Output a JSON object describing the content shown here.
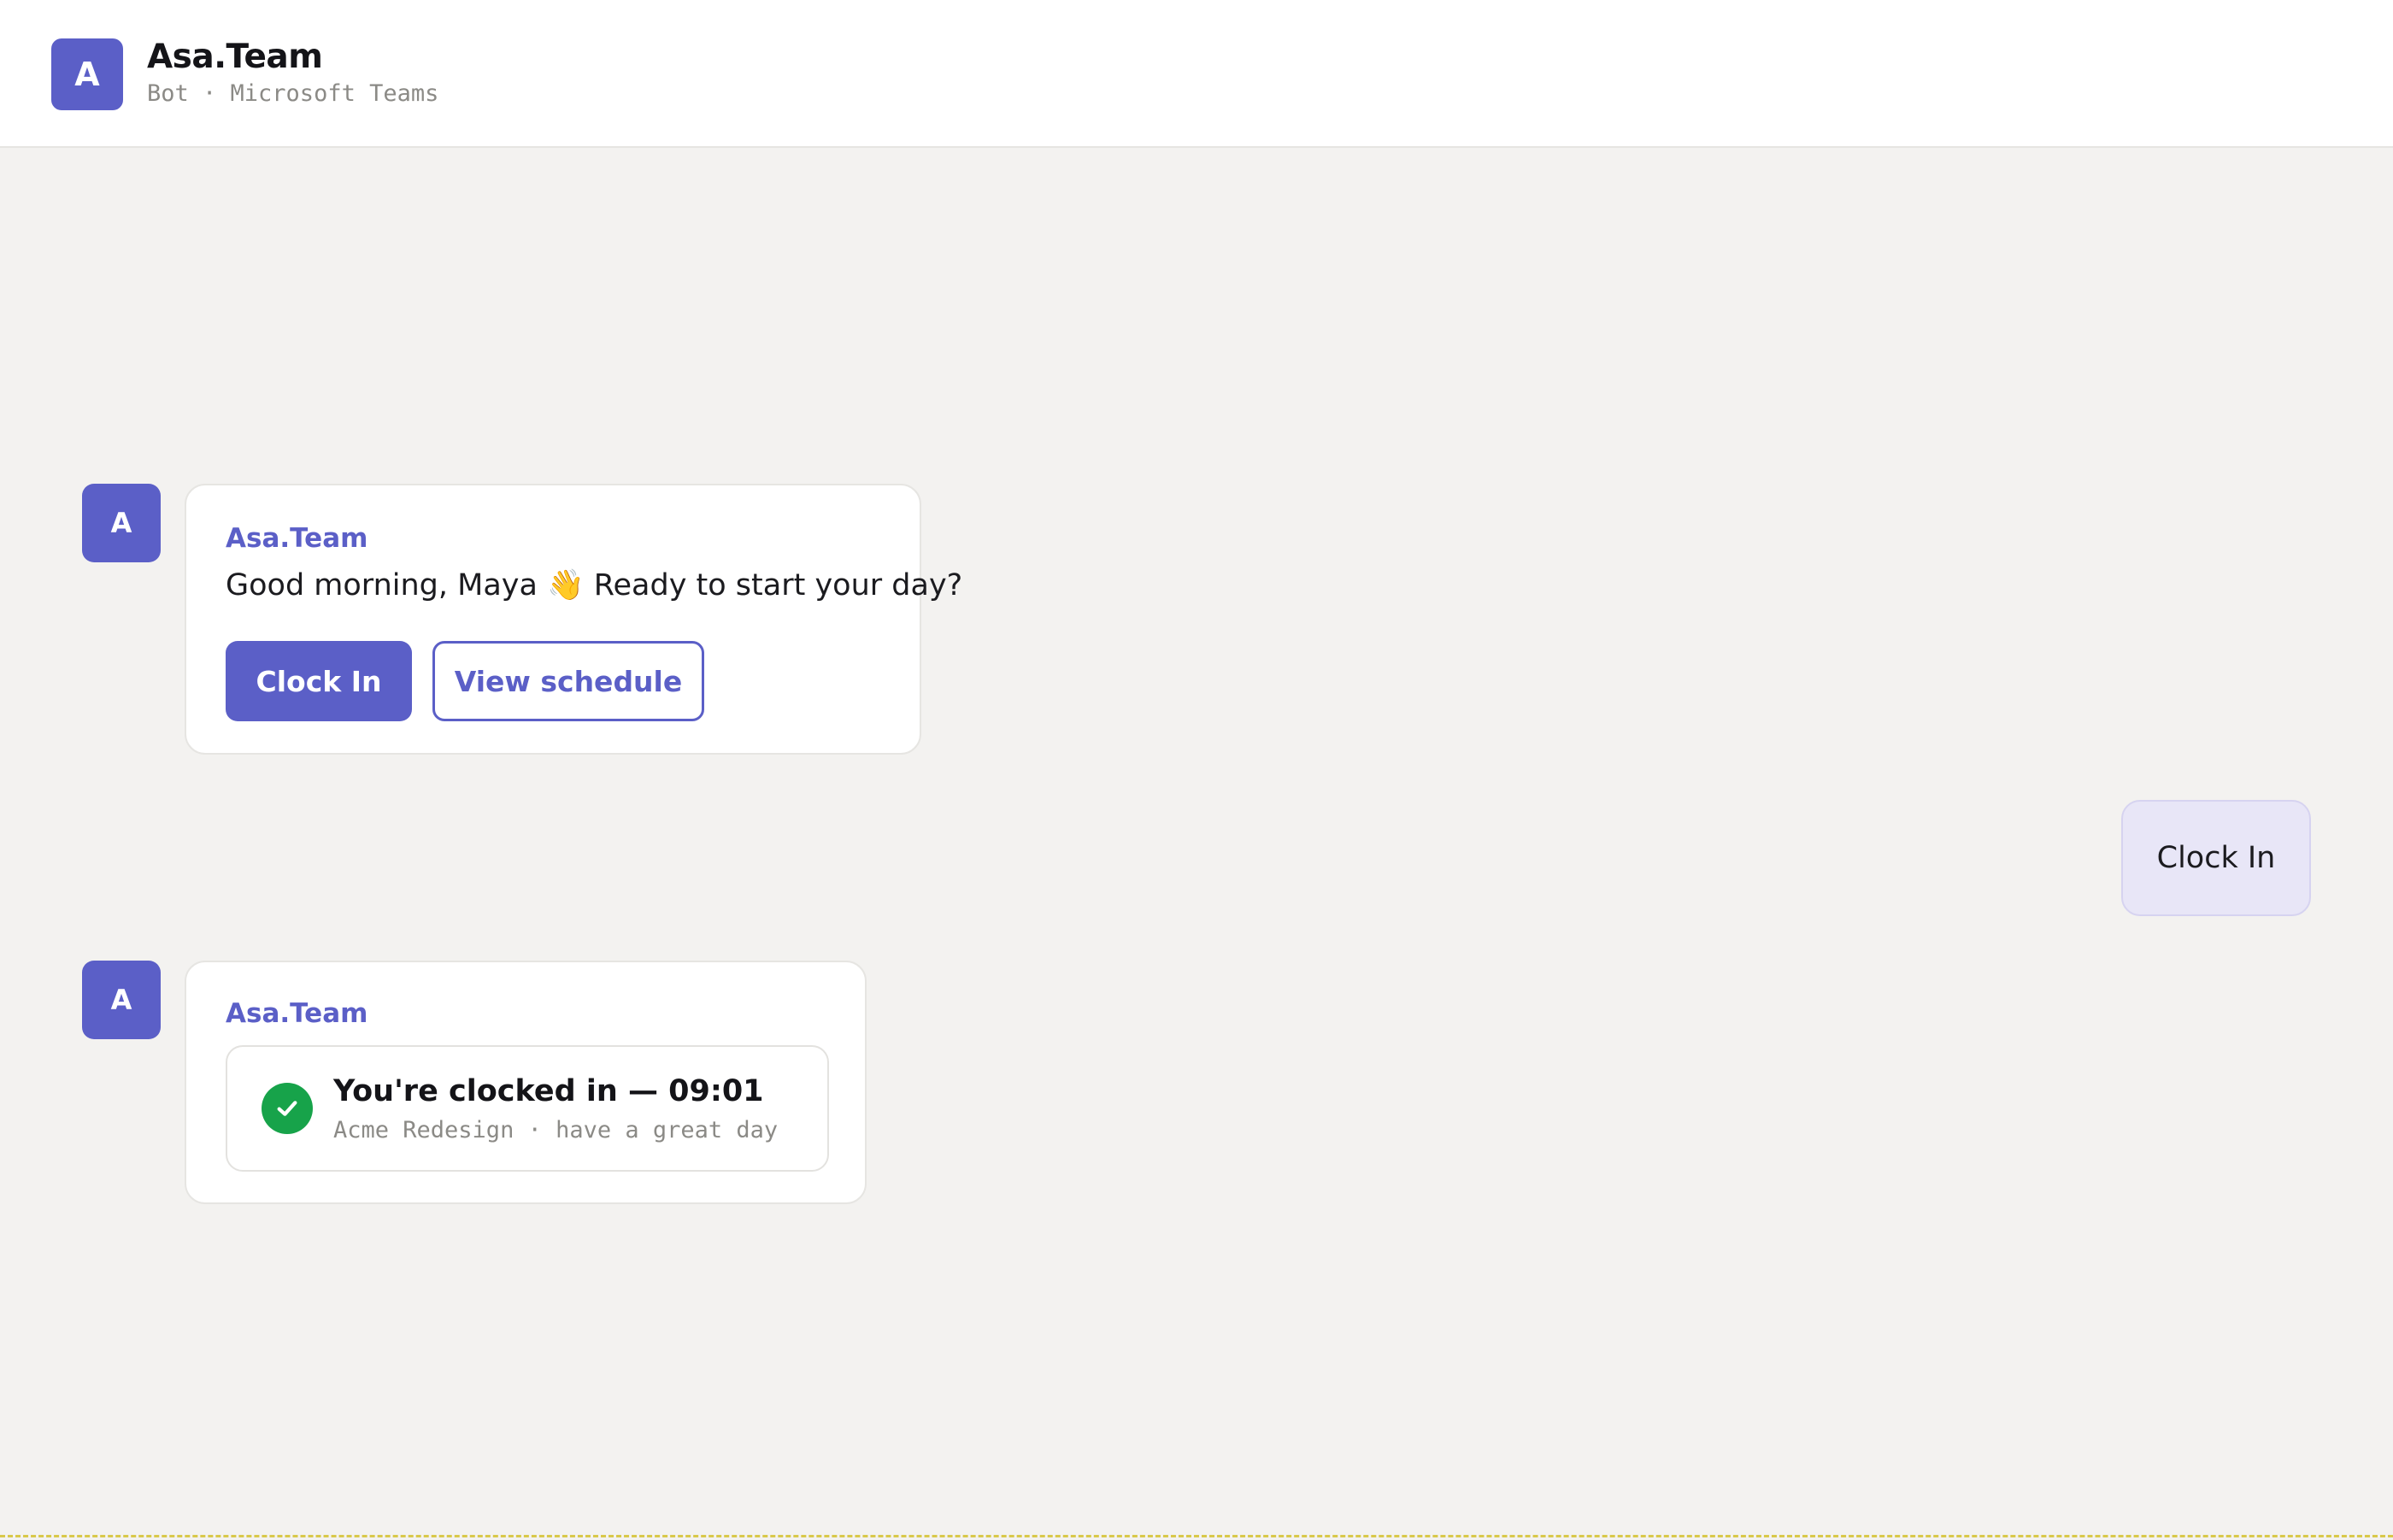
{
  "header": {
    "avatar_letter": "A",
    "title": "Asa.Team",
    "subtitle": "Bot · Microsoft Teams"
  },
  "messages": [
    {
      "avatar_letter": "A",
      "sender": "Asa.Team",
      "text": "Good morning, Maya 👋 Ready to start your day?",
      "actions": {
        "primary": "Clock In",
        "secondary": "View schedule"
      }
    },
    {
      "user_reply": "Clock In"
    },
    {
      "avatar_letter": "A",
      "sender": "Asa.Team",
      "status": {
        "title": "You're clocked in — 09:01",
        "subtitle": "Acme Redesign · have a great day"
      }
    }
  ],
  "colors": {
    "accent": "#5b5fc7",
    "success": "#17a34a",
    "user_bubble": "#e8e6f7",
    "background": "#f3f2f0"
  },
  "icons": {
    "status": "check-circle-icon"
  }
}
